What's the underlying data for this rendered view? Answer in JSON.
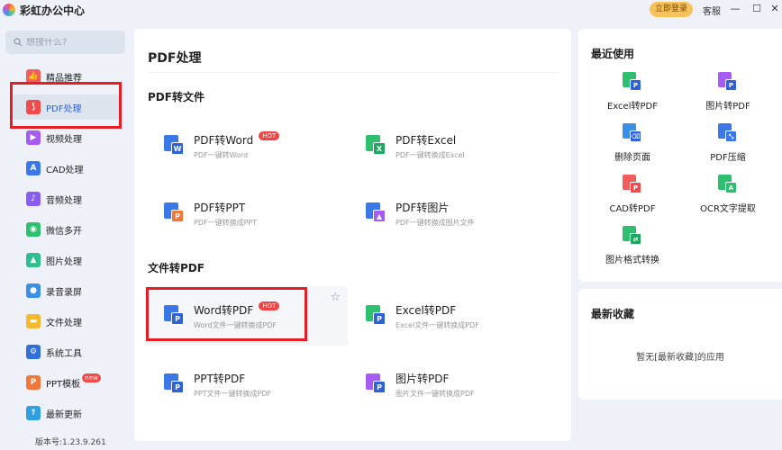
{
  "app": {
    "title": "彩虹办公中心",
    "login": "立即登录",
    "feedback": "客服",
    "minimize": "—",
    "maximize": "☐",
    "close": "✕"
  },
  "search": {
    "placeholder": "想搜什么?"
  },
  "sidebar": {
    "items": [
      {
        "label": "精品推荐",
        "icon": "thumbs-up-icon",
        "color": "#f25c5c",
        "glyph": "👍"
      },
      {
        "label": "PDF处理",
        "icon": "pdf-icon",
        "color": "#f04a4a",
        "glyph": "⟆"
      },
      {
        "label": "视频处理",
        "icon": "video-icon",
        "color": "#a45cf2",
        "glyph": "▶"
      },
      {
        "label": "CAD处理",
        "icon": "cad-icon",
        "color": "#3b78e7",
        "glyph": "A"
      },
      {
        "label": "音频处理",
        "icon": "music-icon",
        "color": "#8a5cf2",
        "glyph": "♪"
      },
      {
        "label": "微信多开",
        "icon": "wechat-icon",
        "color": "#2fbf71",
        "glyph": "◉"
      },
      {
        "label": "图片处理",
        "icon": "image-icon",
        "color": "#2fbf8f",
        "glyph": "▲"
      },
      {
        "label": "录音录屏",
        "icon": "microphone-icon",
        "color": "#3b8fe7",
        "glyph": "●"
      },
      {
        "label": "文件处理",
        "icon": "folder-icon",
        "color": "#f5b82e",
        "glyph": "▬"
      },
      {
        "label": "系统工具",
        "icon": "gear-icon",
        "color": "#2f6fd8",
        "glyph": "⚙"
      },
      {
        "label": "PPT模板",
        "icon": "ppt-icon",
        "color": "#f2773b",
        "glyph": "P",
        "badge": "new"
      },
      {
        "label": "最新更新",
        "icon": "upload-icon",
        "color": "#2f9fe0",
        "glyph": "↑"
      }
    ],
    "version": "版本号:1.23.9.261"
  },
  "main": {
    "title": "PDF处理",
    "sections": [
      {
        "title": "PDF转文件",
        "tools": [
          {
            "name": "PDF转Word",
            "desc": "PDF一键转Word",
            "hot": "HOT",
            "back": "#3b78e7",
            "front": "#2f62d8",
            "letter": "W",
            "icon": "pdf-to-word-icon"
          },
          {
            "name": "PDF转Excel",
            "desc": "PDF一键转换成Excel",
            "back": "#2fbf71",
            "front": "#1ea85f",
            "letter": "X",
            "icon": "pdf-to-excel-icon"
          },
          {
            "name": "PDF转PPT",
            "desc": "PDF一键转换成PPT",
            "back": "#3b78e7",
            "front": "#f2773b",
            "letter": "P",
            "icon": "pdf-to-ppt-icon"
          },
          {
            "name": "PDF转图片",
            "desc": "PDF一键转换成图片文件",
            "back": "#3b78e7",
            "front": "#a45cf2",
            "letter": "▲",
            "icon": "pdf-to-image-icon"
          }
        ]
      },
      {
        "title": "文件转PDF",
        "tools": [
          {
            "name": "Word转PDF",
            "desc": "Word文件一键转换成PDF",
            "hot": "HOT",
            "back": "#3b78e7",
            "front": "#2f62d8",
            "letter": "P",
            "icon": "word-to-pdf-icon"
          },
          {
            "name": "Excel转PDF",
            "desc": "Excel文件一键转换成PDF",
            "back": "#2fbf71",
            "front": "#2f62d8",
            "letter": "P",
            "icon": "excel-to-pdf-icon"
          },
          {
            "name": "PPT转PDF",
            "desc": "PPT文件一键转换成PDF",
            "back": "#3b78e7",
            "front": "#2f62d8",
            "letter": "P",
            "icon": "ppt-to-pdf-icon"
          },
          {
            "name": "图片转PDF",
            "desc": "图片文件一键转换成PDF",
            "back": "#a45cf2",
            "front": "#2f62d8",
            "letter": "P",
            "icon": "image-to-pdf-icon"
          }
        ]
      }
    ],
    "star": "☆"
  },
  "recent": {
    "title": "最近使用",
    "items": [
      {
        "label": "Excel转PDF",
        "back": "#2fbf71",
        "front": "#2f62d8",
        "letter": "P",
        "icon": "excel-to-pdf-icon"
      },
      {
        "label": "图片转PDF",
        "back": "#a45cf2",
        "front": "#2f62d8",
        "letter": "P",
        "icon": "image-to-pdf-icon"
      },
      {
        "label": "删除页面",
        "back": "#3b8fe7",
        "front": "#2f62d8",
        "letter": "⌫",
        "icon": "delete-page-icon"
      },
      {
        "label": "PDF压缩",
        "back": "#3b78e7",
        "front": "#3b78e7",
        "letter": "⤡",
        "icon": "pdf-compress-icon"
      },
      {
        "label": "CAD转PDF",
        "back": "#f25c5c",
        "front": "#f04a4a",
        "letter": "P",
        "icon": "cad-to-pdf-icon"
      },
      {
        "label": "OCR文字提取",
        "back": "#2fbf71",
        "front": "#2fbf71",
        "letter": "A",
        "icon": "ocr-icon"
      },
      {
        "label": "图片格式转换",
        "back": "#2fbf71",
        "front": "#1ea85f",
        "letter": "⇄",
        "icon": "image-convert-icon"
      }
    ]
  },
  "favorites": {
    "title": "最新收藏",
    "empty": "暂无[最新收藏]的应用"
  }
}
